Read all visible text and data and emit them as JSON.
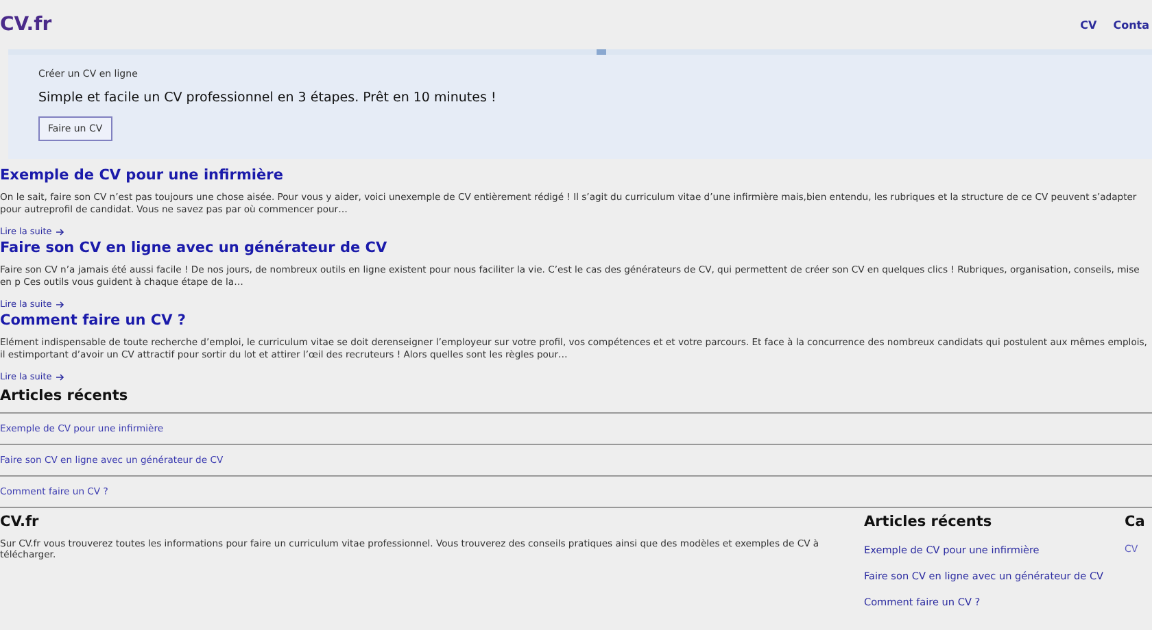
{
  "header": {
    "logo": "CV.fr",
    "nav": [
      "CV",
      "Conta"
    ]
  },
  "hero": {
    "kicker": "Créer un CV en ligne",
    "text": "Simple et facile un CV professionnel en 3 étapes. Prêt en 10 minutes !",
    "button": "Faire un CV"
  },
  "articles": [
    {
      "title": "Exemple de CV pour une infirmière",
      "excerpt": "On le sait, faire son CV n’est pas toujours une chose aisée. Pour vous y aider, voici unexemple de CV entièrement rédigé ! Il s’agit du curriculum vitae d’une infirmière mais,bien entendu, les rubriques et la structure de ce CV peuvent s’adapter pour autreprofil de candidat. Vous ne savez pas par où commencer pour…",
      "more": "Lire la suite"
    },
    {
      "title": "Faire son CV en ligne avec un générateur de CV",
      "excerpt": "Faire son CV n’a jamais été aussi facile ! De nos jours, de nombreux outils en ligne existent pour nous faciliter la vie. C’est le cas des générateurs de CV, qui permettent de créer son CV en quelques clics ! Rubriques, organisation, conseils, mise en p Ces outils vous guident à chaque étape de la…",
      "more": "Lire la suite"
    },
    {
      "title": "Comment faire un CV ?",
      "excerpt": "Elément indispensable de toute recherche d’emploi, le curriculum vitae se doit derenseigner l’employeur sur votre profil, vos compétences et et votre parcours. Et face à la concurrence des nombreux candidats qui postulent aux mêmes emplois, il estimportant d’avoir un CV attractif pour sortir du lot et attirer l’œil des recruteurs ! Alors quelles sont les règles pour…",
      "more": "Lire la suite"
    }
  ],
  "recent": {
    "title": "Articles récents",
    "links": [
      "Exemple de CV pour une infirmière",
      "Faire son CV en ligne avec un générateur de CV",
      "Comment faire un CV ?"
    ]
  },
  "footer": {
    "about_title": "CV.fr",
    "about_text": "Sur CV.fr vous trouverez toutes les informations pour faire un curriculum vitae professionnel. Vous trouverez des conseils pratiques ainsi que des modèles et exemples de CV à télécharger.",
    "recent_title": "Articles récents",
    "recent_links": [
      "Exemple de CV pour une infirmière",
      "Faire son CV en ligne avec un générateur de CV",
      "Comment faire un CV ?"
    ],
    "column_3_title": "Ca",
    "column_3_link": "CV"
  }
}
